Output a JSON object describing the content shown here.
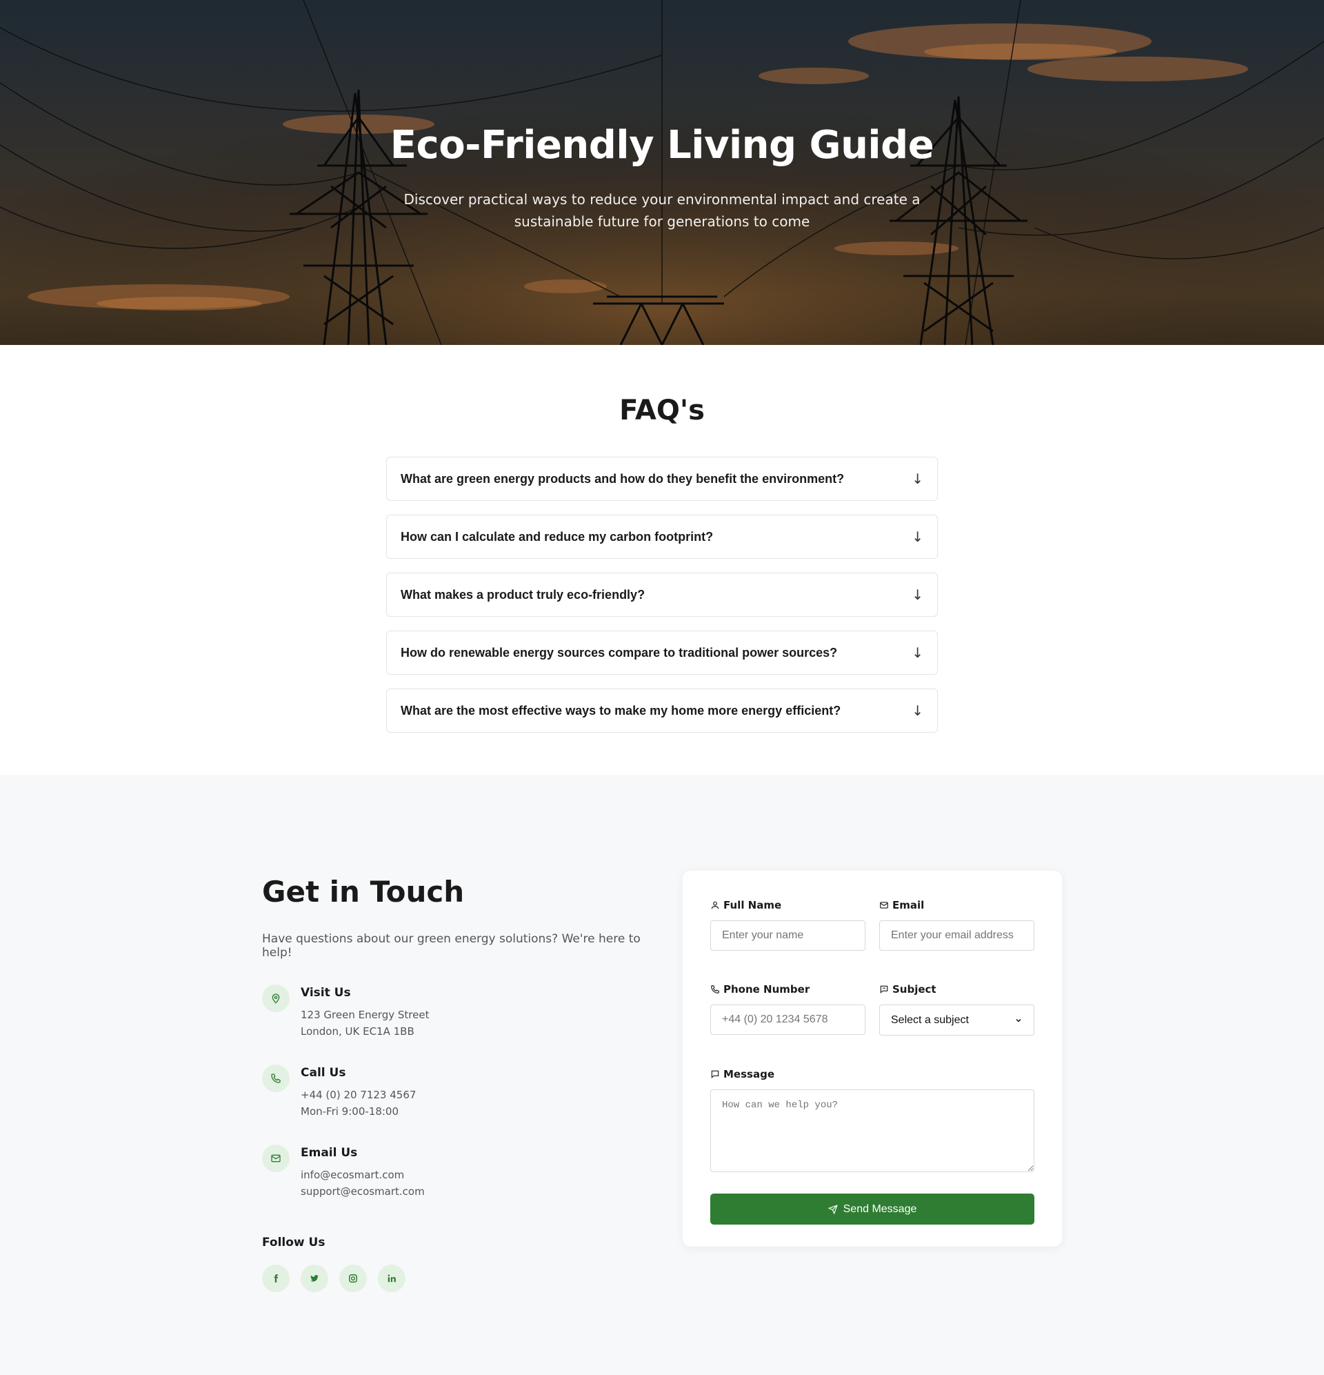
{
  "hero": {
    "title": "Eco-Friendly Living Guide",
    "subtitle": "Discover practical ways to reduce your environmental impact and create a sustainable future for generations to come"
  },
  "faq": {
    "title": "FAQ's",
    "arrow": "↓",
    "items": [
      {
        "question": "What are green energy products and how do they benefit the environment?"
      },
      {
        "question": "How can I calculate and reduce my carbon footprint?"
      },
      {
        "question": "What makes a product truly eco-friendly?"
      },
      {
        "question": "How do renewable energy sources compare to traditional power sources?"
      },
      {
        "question": "What are the most effective ways to make my home more energy efficient?"
      }
    ]
  },
  "contact": {
    "title": "Get in Touch",
    "intro": "Have questions about our green energy solutions? We're here to help!",
    "visit": {
      "heading": "Visit Us",
      "line1": "123 Green Energy Street",
      "line2": "London, UK EC1A 1BB",
      "icon": "map-pin-icon"
    },
    "call": {
      "heading": "Call Us",
      "line1": "+44 (0) 20 7123 4567",
      "line2": "Mon-Fri 9:00-18:00",
      "icon": "phone-icon"
    },
    "email": {
      "heading": "Email Us",
      "line1": "info@ecosmart.com",
      "line2": "support@ecosmart.com",
      "icon": "mail-icon"
    },
    "follow": {
      "heading": "Follow Us",
      "networks": [
        "facebook",
        "twitter",
        "instagram",
        "linkedin"
      ]
    },
    "accent": "#2e7d32",
    "icon_bg": "#e3f1e3"
  },
  "form": {
    "full_name": {
      "label": "Full Name",
      "placeholder": "Enter your name",
      "value": ""
    },
    "email": {
      "label": "Email",
      "placeholder": "Enter your email address",
      "value": ""
    },
    "phone": {
      "label": "Phone Number",
      "placeholder": "+44 (0) 20 1234 5678",
      "value": ""
    },
    "subject": {
      "label": "Subject",
      "selected": "Select a subject"
    },
    "message": {
      "label": "Message",
      "placeholder": "How can we help you?",
      "value": ""
    },
    "submit_label": "Send Message"
  }
}
